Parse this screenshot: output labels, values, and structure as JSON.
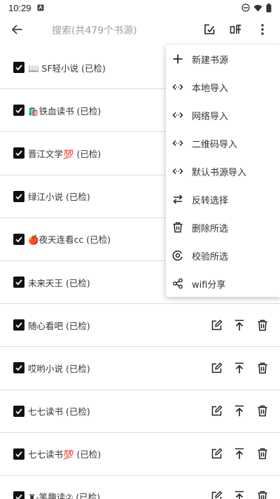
{
  "status": {
    "time": "10:29"
  },
  "search": {
    "placeholder": "搜索(共479个书源)"
  },
  "sources": [
    {
      "name": "📖 SF轻小说 (已检)"
    },
    {
      "name": "🛍️铁血读书 (已检)"
    },
    {
      "name": "晋江文学💯 (已检)"
    },
    {
      "name": "绿江小说 (已检)"
    },
    {
      "name": "🍎夜天连看cc (已检)"
    },
    {
      "name": "未来天王 (已检)"
    },
    {
      "name": "随心看吧 (已检)"
    },
    {
      "name": "哎哟小说 (已检)"
    },
    {
      "name": "七七读书 (已检)"
    },
    {
      "name": "七七读书💯 (已检)"
    },
    {
      "name": "♜-笔趣读② (已检)"
    }
  ],
  "menu": [
    {
      "label": "新建书源",
      "icon": "plus-icon"
    },
    {
      "label": "本地导入",
      "icon": "code-icon"
    },
    {
      "label": "网络导入",
      "icon": "code-icon"
    },
    {
      "label": "二维码导入",
      "icon": "code-icon"
    },
    {
      "label": "默认书源导入",
      "icon": "code-icon"
    },
    {
      "label": "反转选择",
      "icon": "swap-icon"
    },
    {
      "label": "删除所选",
      "icon": "trash-icon"
    },
    {
      "label": "校验所选",
      "icon": "check-circle-icon"
    },
    {
      "label": "wifi分享",
      "icon": "share-icon"
    }
  ]
}
